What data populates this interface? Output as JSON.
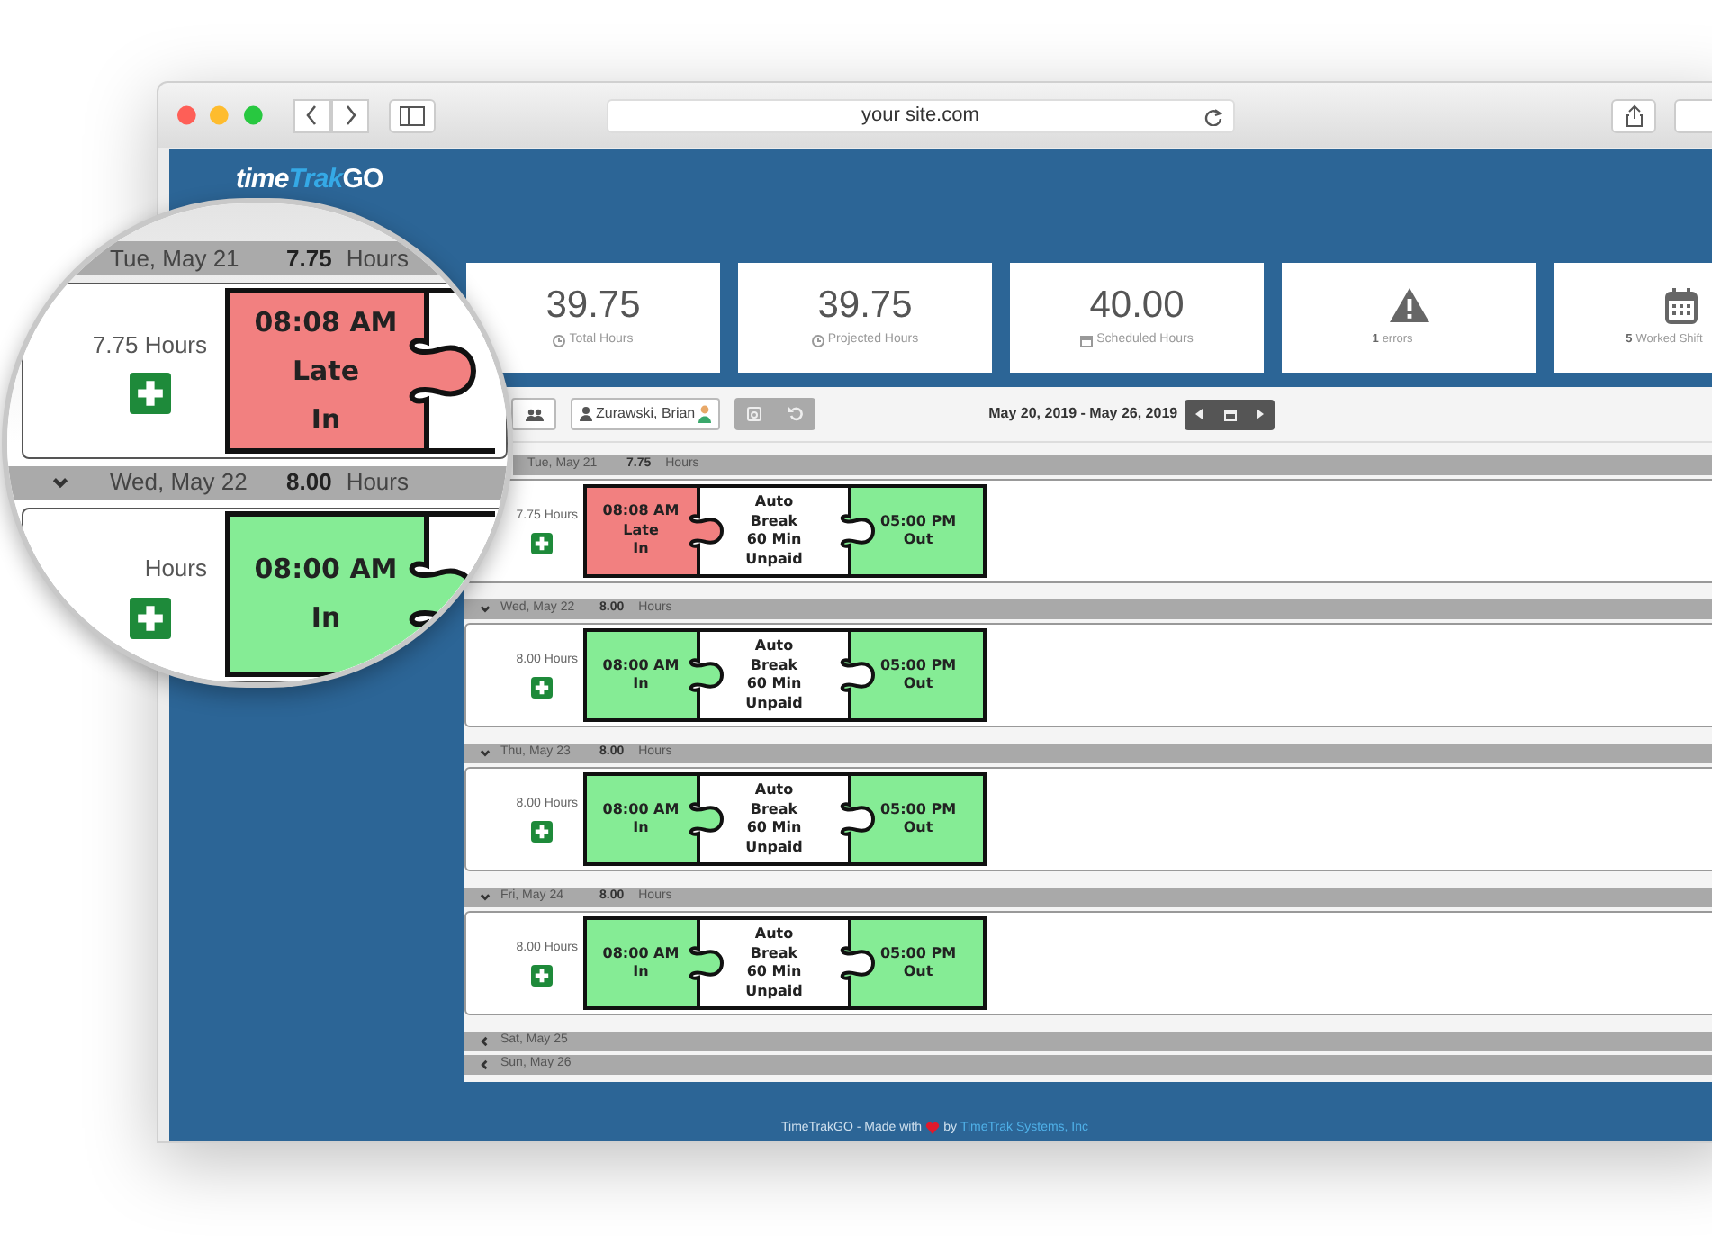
{
  "browser": {
    "url": "your site.com"
  },
  "logo": {
    "parts": [
      "time",
      "Trak",
      "GO"
    ]
  },
  "stats": [
    {
      "kind": "value",
      "value": "39.75",
      "label": "Total Hours"
    },
    {
      "kind": "value",
      "value": "39.75",
      "label": "Projected Hours"
    },
    {
      "kind": "value",
      "value": "40.00",
      "label": "Scheduled Hours"
    },
    {
      "kind": "alert",
      "count": "1",
      "label": "errors"
    },
    {
      "kind": "calendar",
      "count": "5",
      "label": "Worked Shift"
    }
  ],
  "toolbar": {
    "employee": "Zurawski, Brian",
    "date_range": "May 20, 2019 - May 26, 2019"
  },
  "days": [
    {
      "label": "Tue, May 21",
      "total": "7.75",
      "unit": "Hours",
      "summary": "7.75 Hours",
      "punch_in": {
        "lines": [
          "08:08 AM",
          "Late",
          "In"
        ],
        "late": true
      },
      "break": {
        "lines": [
          "Auto",
          "Break",
          "60 Min",
          "Unpaid"
        ]
      },
      "punch_out": {
        "lines": [
          "05:00 PM",
          "Out"
        ],
        "late": false
      }
    },
    {
      "label": "Wed, May 22",
      "expanded": true,
      "total": "8.00",
      "unit": "Hours",
      "summary": "8.00 Hours",
      "punch_in": {
        "lines": [
          "08:00 AM",
          "In"
        ],
        "late": false
      },
      "break": {
        "lines": [
          "Auto",
          "Break",
          "60 Min",
          "Unpaid"
        ]
      },
      "punch_out": {
        "lines": [
          "05:00 PM",
          "Out"
        ],
        "late": false
      }
    },
    {
      "label": "Thu, May 23",
      "expanded": true,
      "total": "8.00",
      "unit": "Hours",
      "summary": "8.00 Hours",
      "punch_in": {
        "lines": [
          "08:00 AM",
          "In"
        ],
        "late": false
      },
      "break": {
        "lines": [
          "Auto",
          "Break",
          "60 Min",
          "Unpaid"
        ]
      },
      "punch_out": {
        "lines": [
          "05:00 PM",
          "Out"
        ],
        "late": false
      }
    },
    {
      "label": "Fri, May 24",
      "expanded": true,
      "total": "8.00",
      "unit": "Hours",
      "summary": "8.00 Hours",
      "punch_in": {
        "lines": [
          "08:00 AM",
          "In"
        ],
        "late": false
      },
      "break": {
        "lines": [
          "Auto",
          "Break",
          "60 Min",
          "Unpaid"
        ]
      },
      "punch_out": {
        "lines": [
          "05:00 PM",
          "Out"
        ],
        "late": false
      }
    },
    {
      "label": "Sat, May 25",
      "expanded": false
    },
    {
      "label": "Sun, May 26",
      "expanded": false
    }
  ],
  "footer": {
    "text": "TimeTrakGO - Made with",
    "by": "by",
    "link": "TimeTrak Systems, Inc"
  },
  "magnifier": {
    "days": [
      {
        "label": "Tue, May 21",
        "total": "7.75",
        "unit": "Hours",
        "summary": "7.75 Hours",
        "punch_in": {
          "lines": [
            "08:08 AM",
            "Late",
            "In"
          ],
          "late": true
        }
      },
      {
        "label": "Wed, May 22",
        "expanded": true,
        "total": "8.00",
        "unit": "Hours",
        "summary": "Hours",
        "punch_in": {
          "lines": [
            "08:00 AM",
            "In"
          ],
          "late": false
        }
      }
    ]
  }
}
